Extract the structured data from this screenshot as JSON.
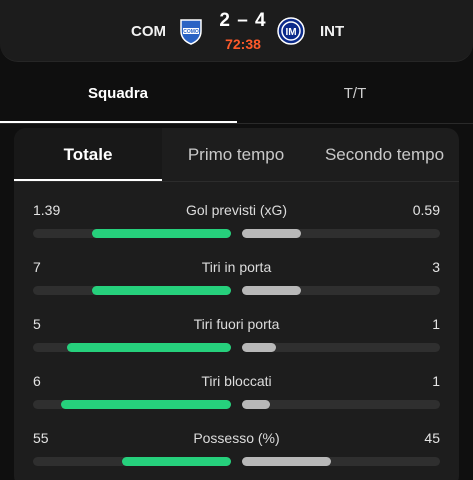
{
  "match": {
    "home_code": "COM",
    "away_code": "INT",
    "score": "2 – 4",
    "clock": "72:38",
    "home_crest_text": "COMO",
    "away_crest_text": "IM"
  },
  "top_tabs": [
    {
      "label": "Squadra",
      "active": true
    },
    {
      "label": "T/T",
      "active": false
    }
  ],
  "period_tabs": [
    {
      "label": "Totale",
      "active": true
    },
    {
      "label": "Primo tempo",
      "active": false
    },
    {
      "label": "Secondo tempo",
      "active": false
    }
  ],
  "stats": [
    {
      "label": "Gol previsti (xG)",
      "home": "1.39",
      "away": "0.59",
      "home_share": 0.7,
      "away_share": 0.3
    },
    {
      "label": "Tiri in porta",
      "home": "7",
      "away": "3",
      "home_share": 0.7,
      "away_share": 0.3
    },
    {
      "label": "Tiri fuori porta",
      "home": "5",
      "away": "1",
      "home_share": 0.83,
      "away_share": 0.17
    },
    {
      "label": "Tiri bloccati",
      "home": "6",
      "away": "1",
      "home_share": 0.86,
      "away_share": 0.14
    },
    {
      "label": "Possesso (%)",
      "home": "55",
      "away": "45",
      "home_share": 0.55,
      "away_share": 0.45
    }
  ],
  "colors": {
    "home_bar": "#26d07c",
    "away_bar": "#b8b8b8",
    "clock": "#ff5a2a",
    "background": "#0f0f0f",
    "card": "#1d1d1d"
  }
}
